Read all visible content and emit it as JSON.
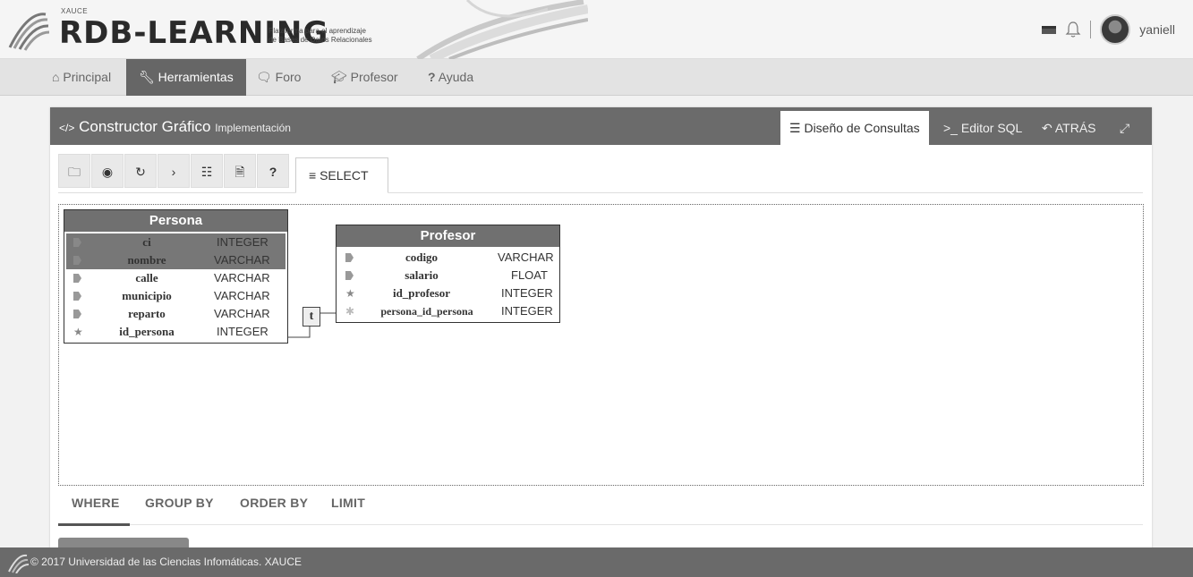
{
  "header": {
    "logo_small": "XAUCE",
    "logo_big": "RDB-LEARNING",
    "logo_subtitle_1": "Plataforma para el aprendizaje",
    "logo_subtitle_2": "de Bases de Datos Relacionales",
    "username": "yaniell"
  },
  "nav": {
    "items": [
      {
        "label": "Principal",
        "icon": "home-icon"
      },
      {
        "label": "Herramientas",
        "icon": "wrench-icon"
      },
      {
        "label": "Foro",
        "icon": "comments-icon"
      },
      {
        "label": "Profesor",
        "icon": "graduation-cap-icon"
      },
      {
        "label": "Ayuda",
        "icon": "question-icon"
      }
    ],
    "active": "Herramientas"
  },
  "panel": {
    "title": "Constructor Gráfico",
    "subtitle": "Implementación",
    "tabs": [
      {
        "label": "Diseño de Consultas",
        "icon": "sitemap-icon"
      },
      {
        "label": "Editor SQL",
        "icon": "terminal-icon"
      },
      {
        "label": "ATRÁS",
        "icon": "reply-icon"
      }
    ],
    "active_tab": "Diseño de Consultas"
  },
  "toolbar": {
    "buttons": [
      "folder-icon",
      "eye-icon",
      "refresh-icon",
      "chevron-right-icon",
      "sitemap-icon",
      "file-icon",
      "question-icon"
    ],
    "question_label": "?",
    "chevron_label": "›",
    "select_tab": "SELECT"
  },
  "diagram": {
    "persona": {
      "name": "Persona",
      "fields": [
        {
          "name": "ci",
          "type": "INTEGER",
          "key": "field",
          "selected": true
        },
        {
          "name": "nombre",
          "type": "VARCHAR",
          "key": "field",
          "selected": true
        },
        {
          "name": "calle",
          "type": "VARCHAR",
          "key": "field",
          "selected": false
        },
        {
          "name": "municipio",
          "type": "VARCHAR",
          "key": "field",
          "selected": false
        },
        {
          "name": "reparto",
          "type": "VARCHAR",
          "key": "field",
          "selected": false
        },
        {
          "name": "id_persona",
          "type": "INTEGER",
          "key": "primary",
          "selected": false
        }
      ]
    },
    "profesor": {
      "name": "Profesor",
      "fields": [
        {
          "name": "codigo",
          "type": "VARCHAR",
          "key": "field"
        },
        {
          "name": "salario",
          "type": "FLOAT",
          "key": "field"
        },
        {
          "name": "id_profesor",
          "type": "INTEGER",
          "key": "primary"
        },
        {
          "name": "persona_id_persona",
          "type": "INTEGER",
          "key": "foreign"
        }
      ]
    },
    "relation_label": "t"
  },
  "clauses": [
    "WHERE",
    "GROUP BY",
    "ORDER BY",
    "LIMIT"
  ],
  "footer": {
    "text": "© 2017 Universidad de las Ciencias Infomáticas. XAUCE"
  }
}
